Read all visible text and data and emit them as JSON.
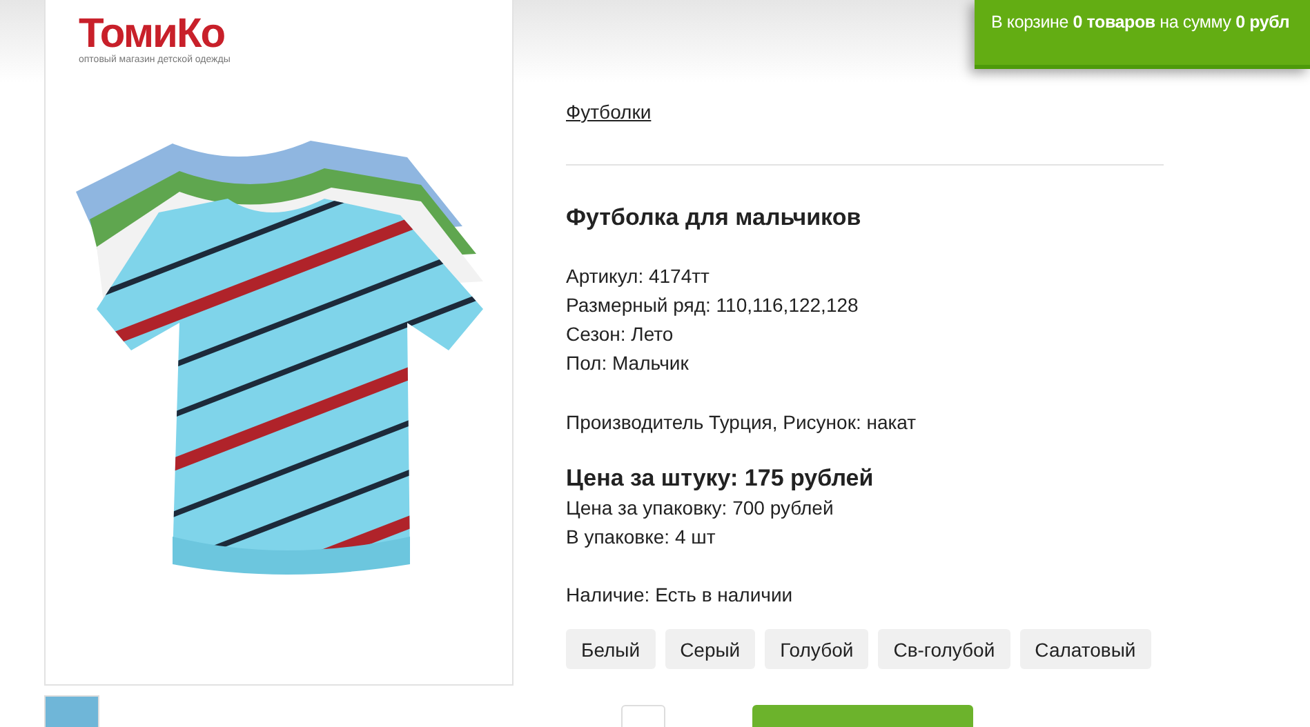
{
  "logo": {
    "text": "ТомиКо",
    "tagline": "оптовый магазин детской одежды"
  },
  "cart": {
    "prefix": "В корзине",
    "count": "0 товаров",
    "middle": "на сумму",
    "sum": "0 рубл"
  },
  "breadcrumb": "Футболки",
  "product": {
    "title": "Футболка для мальчиков",
    "specs": [
      "Артикул: 4174тт",
      "Размерный ряд: 110,116,122,128",
      "Сезон: Лето",
      "Пол: Мальчик"
    ],
    "origin": "Производитель Турция, Рисунок: накат",
    "price": "Цена за штуку: 175 рублей",
    "pack_price": "Цена за упаковку: 700 рублей",
    "pack_count": "В упаковке: 4 шт",
    "availability": "Наличие: Есть в наличии",
    "colors": [
      "Белый",
      "Серый",
      "Голубой",
      "Св-голубой",
      "Салатовый"
    ]
  }
}
